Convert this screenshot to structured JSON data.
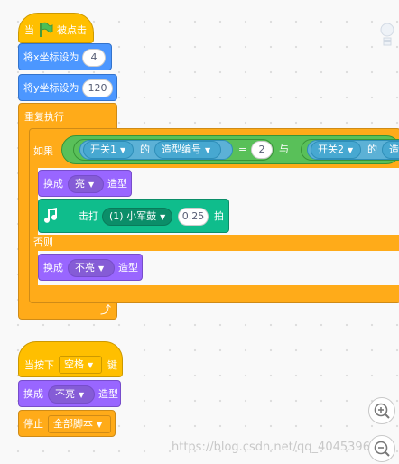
{
  "script1": {
    "hat_when": "当",
    "hat_clicked": "被点击",
    "set_x_label": "将x坐标设为",
    "set_x_value": "4",
    "set_y_label": "将y坐标设为",
    "set_y_value": "120",
    "forever_label": "重复执行",
    "if_label": "如果",
    "else_label": "否则",
    "cond": {
      "sensor1": "开关1",
      "of1": "的",
      "costume_num1": "造型编号",
      "equals": "=",
      "value1": "2",
      "and": "与",
      "sensor2": "开关2",
      "of2": "的",
      "costume_num2_partial": "造"
    },
    "switch_costume_label": "换成",
    "costume_on": "亮",
    "costume_suffix": "造型",
    "drum_label": "击打",
    "drum_value": "(1) 小军鼓",
    "beats_value": "0.25",
    "beats_label": "拍",
    "else_costume_value": "不亮",
    "else_costume_suffix": "造型"
  },
  "script2": {
    "hat_label": "当按下",
    "key_value": "空格",
    "hat_suffix": "键",
    "switch_label": "换成",
    "costume_value": "不亮",
    "costume_suffix": "造型",
    "stop_label": "停止",
    "stop_option": "全部脚本"
  },
  "watermark": "https://blog.csdn.net/qq_4045396",
  "icons": [
    "green-flag-icon",
    "music-note-icon",
    "loop-arrow-icon",
    "zoom-in-icon",
    "zoom-out-icon",
    "sprite-thumbnail-icon"
  ],
  "colors": {
    "events": "#ffbf00",
    "motion": "#4c97ff",
    "control": "#ffab19",
    "looks": "#9966ff",
    "operators": "#59c059",
    "sensing": "#5cb1d6",
    "music": "#0fbd8c"
  }
}
